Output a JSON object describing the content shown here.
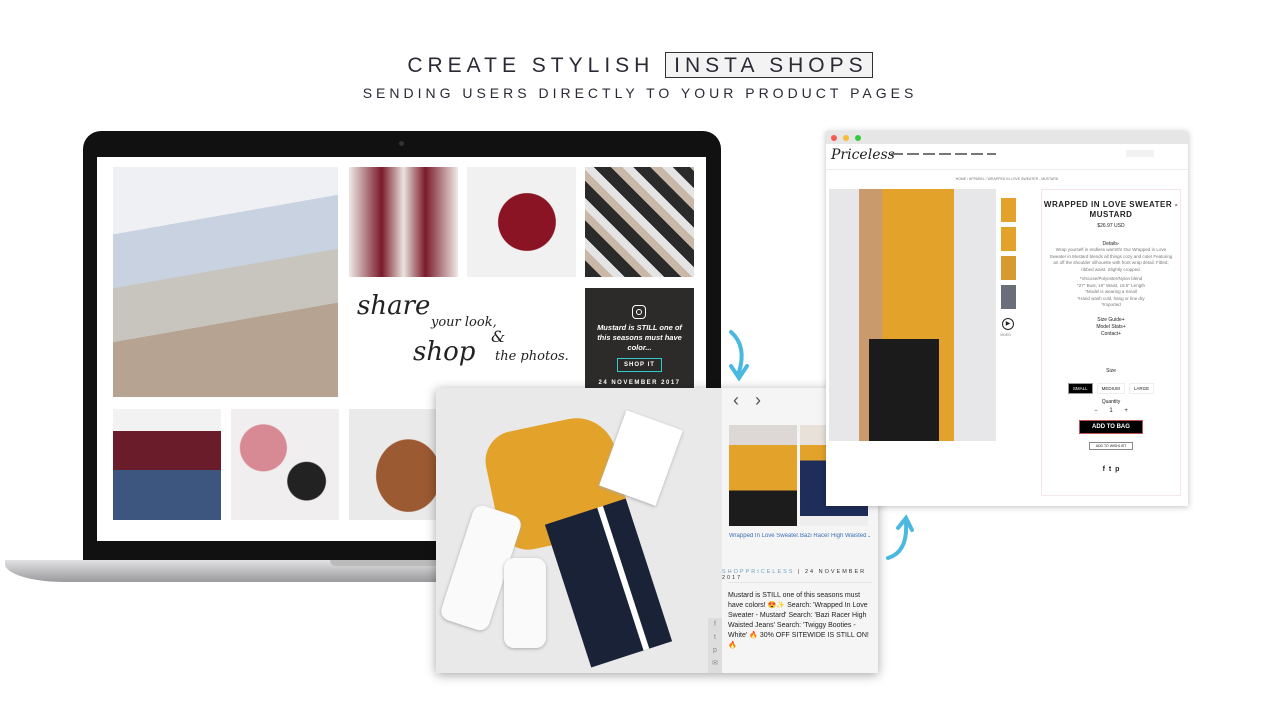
{
  "headline": {
    "lead": "CREATE STYLISH",
    "highlight": "INSTA SHOPS",
    "sub": "SENDING USERS DIRECTLY TO YOUR PRODUCT PAGES"
  },
  "laptop": {
    "share": {
      "l1": "share",
      "l2": "your look,",
      "l3": "&",
      "l4": "shop",
      "l5": "the photos."
    },
    "feature": {
      "icon": "instagram-icon",
      "caption": "Mustard is STILL one of this seasons must have color...",
      "button": "SHOP IT",
      "date": "24 NOVEMBER 2017"
    }
  },
  "popup": {
    "products": [
      {
        "label": "Wrapped In Love Sweater..."
      },
      {
        "label": "Bazi Racer High Waisted J..."
      }
    ],
    "account": "SHOPPRICELESS",
    "separator": "|",
    "date": "24 NOVEMBER 2017",
    "caption": "Mustard is STILL one of this seasons must have colors! 😍✨ Search: 'Wrapped In Love Sweater - Mustard' Search: 'Bazi Racer High Waisted Jeans' Search: 'Twiggy Booties - White' 🔥 30% OFF SITEWIDE IS STILL ON! 🔥",
    "share_icons": [
      "facebook-icon",
      "twitter-icon",
      "pinterest-icon",
      "email-icon"
    ]
  },
  "store": {
    "logo": "Priceless",
    "breadcrumb": "HOME / APPAREL / WRAPPED IN LOVE SWEATER - MUSTARD",
    "title": "WRAPPED IN LOVE SWEATER - MUSTARD",
    "price": "$26.97 USD",
    "details_label": "Details-",
    "description": "Wrap yourself in endless warmth! Our Wrapped in Love Sweater in Mustard blends all things cozy and cute! Featuring an off the shoulder silhouette with front wrap detail. Fitted, ribbed waist. Slightly cropped.",
    "specs": [
      "*Viscose/Polyester/Nylon blend",
      "*27\" Bust, 19\" Waist, 15.5\" Length",
      "*Model is wearing a Small",
      "*Hand wash cold, hang or line dry",
      "*Imported"
    ],
    "links": [
      "Size Guide+",
      "Model Stats+",
      "Contact+"
    ],
    "size_label": "Size",
    "sizes": [
      "SMALL",
      "MEDIUM",
      "LARGE"
    ],
    "selected_size": "SMALL",
    "quantity_label": "Quantity",
    "minus": "−",
    "quantity": "1",
    "plus": "+",
    "add_to_bag": "ADD TO BAG",
    "add_to_wishlist": "ADD TO WISHLIST",
    "video_label": "VIDEO",
    "social": [
      "f",
      "t",
      "p"
    ]
  },
  "colors": {
    "accent": "#4bb8e0",
    "mustard": "#e3a22a",
    "burgundy": "#7a1b2a",
    "teal": "#33cccc"
  }
}
